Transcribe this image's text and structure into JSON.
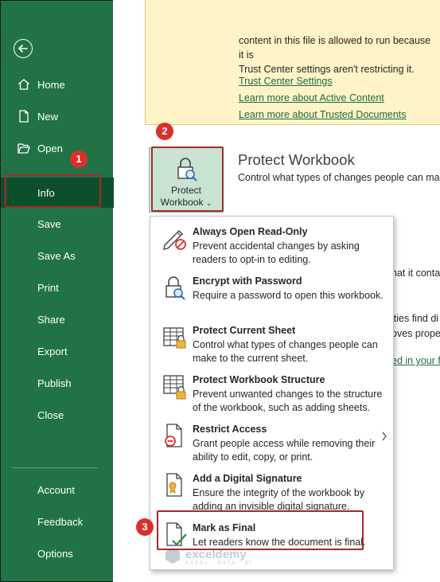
{
  "sidebar": {
    "back_label": "Back",
    "items": [
      {
        "label": "Home"
      },
      {
        "label": "New"
      },
      {
        "label": "Open"
      },
      {
        "label": "Info"
      },
      {
        "label": "Save"
      },
      {
        "label": "Save As"
      },
      {
        "label": "Print"
      },
      {
        "label": "Share"
      },
      {
        "label": "Export"
      },
      {
        "label": "Publish"
      },
      {
        "label": "Close"
      }
    ],
    "bottom_items": [
      {
        "label": "Account"
      },
      {
        "label": "Feedback"
      },
      {
        "label": "Options"
      }
    ],
    "active_item": "Info"
  },
  "trust_box": {
    "text_line1": "content in this file is allowed to run because it is",
    "text_line2": "Trust Center settings aren't restricting it.",
    "links": [
      "Trust Center Settings",
      "Learn more about Active Content",
      "Learn more about Trusted Documents"
    ]
  },
  "protect": {
    "button_line1": "Protect",
    "button_line2": "Workbook",
    "title": "Protect Workbook",
    "description": "Control what types of changes people can make"
  },
  "background_fragments": {
    "frag1": "hat it conta",
    "frag2": "ities find di",
    "frag3": "oves prope",
    "frag4": "ed in your f"
  },
  "menu": {
    "items": [
      {
        "title": "Always Open Read-Only",
        "desc": "Prevent accidental changes by asking readers to opt-in to editing.",
        "icon": "pencil-no-icon"
      },
      {
        "title": "Encrypt with Password",
        "desc": "Require a password to open this workbook.",
        "icon": "lock-key-icon"
      },
      {
        "title": "Protect Current Sheet",
        "desc": "Control what types of changes people can make to the current sheet.",
        "icon": "sheet-lock-icon"
      },
      {
        "title": "Protect Workbook Structure",
        "desc": "Prevent unwanted changes to the structure of the workbook, such as adding sheets.",
        "icon": "workbook-lock-icon"
      },
      {
        "title": "Restrict Access",
        "desc": "Grant people access while removing their ability to edit, copy, or print.",
        "icon": "restrict-access-icon"
      },
      {
        "title": "Add a Digital Signature",
        "desc": "Ensure the integrity of the workbook by adding an invisible digital signature.",
        "icon": "digital-signature-icon"
      },
      {
        "title": "Mark as Final",
        "desc": "Let readers know the document is final.",
        "icon": "mark-final-icon"
      }
    ]
  },
  "annotations": {
    "badge1": "1",
    "badge2": "2",
    "badge3": "3"
  },
  "watermark": {
    "name": "exceldemy",
    "tagline": "EXCEL · DATA · BI"
  },
  "colors": {
    "sidebar": "#217346",
    "sidebar_active": "#0e4f2b",
    "trust_box": "#fff4c8",
    "protect_button": "#c9e3d2",
    "highlight": "#a52a2a",
    "badge": "#d9312a",
    "link": "#1e6b3c"
  }
}
